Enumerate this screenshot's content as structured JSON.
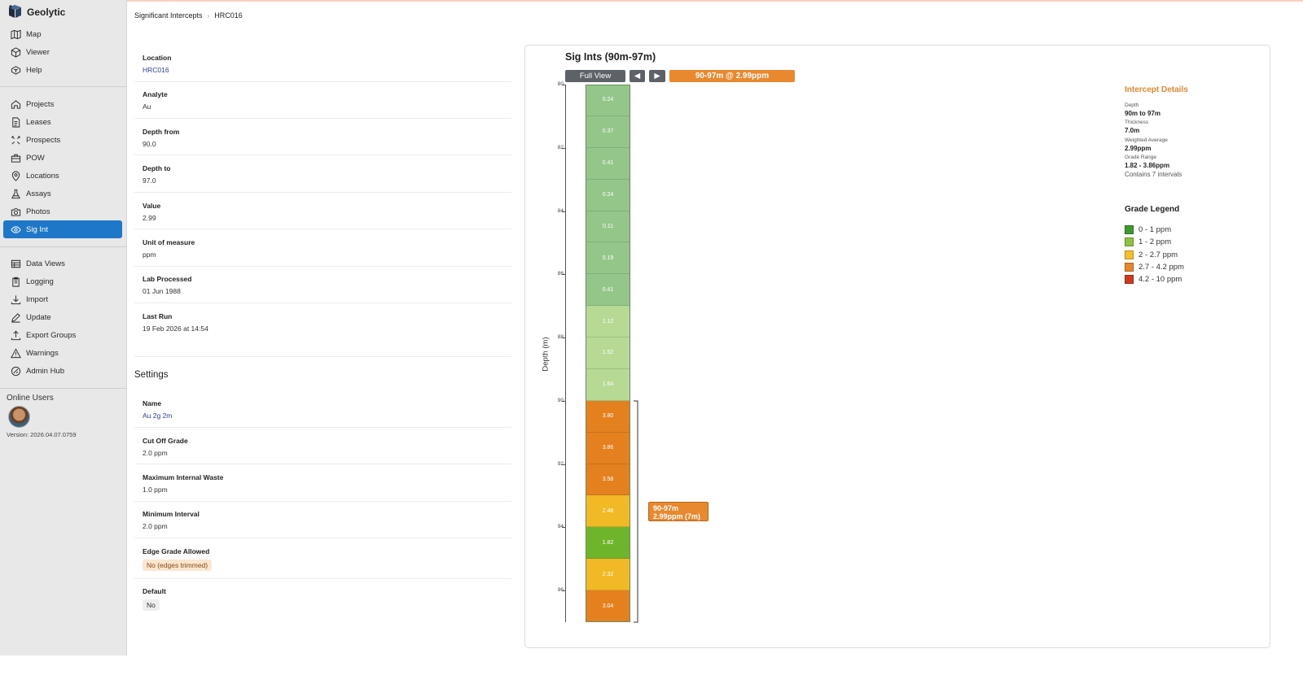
{
  "app": {
    "name": "Geolytic"
  },
  "sidebar": {
    "group1": [
      {
        "label": "Map",
        "icon": "map-icon"
      },
      {
        "label": "Viewer",
        "icon": "cube-icon"
      },
      {
        "label": "Help",
        "icon": "help-icon"
      }
    ],
    "group2": [
      {
        "label": "Projects",
        "icon": "home-icon"
      },
      {
        "label": "Leases",
        "icon": "document-icon"
      },
      {
        "label": "Prospects",
        "icon": "prospects-icon"
      },
      {
        "label": "POW",
        "icon": "briefcase-icon"
      },
      {
        "label": "Locations",
        "icon": "pin-icon"
      },
      {
        "label": "Assays",
        "icon": "flask-icon"
      },
      {
        "label": "Photos",
        "icon": "camera-icon"
      },
      {
        "label": "Sig Int",
        "icon": "eye-icon",
        "active": true
      }
    ],
    "group3": [
      {
        "label": "Data Views",
        "icon": "table-icon"
      },
      {
        "label": "Logging",
        "icon": "clipboard-icon"
      },
      {
        "label": "Import",
        "icon": "download-icon"
      },
      {
        "label": "Update",
        "icon": "edit-icon"
      },
      {
        "label": "Export Groups",
        "icon": "upload-icon"
      },
      {
        "label": "Warnings",
        "icon": "warning-icon"
      },
      {
        "label": "Admin Hub",
        "icon": "admin-icon"
      }
    ],
    "online_users_label": "Online Users",
    "version": "Version: 2026.04.07.0759"
  },
  "breadcrumb": {
    "parent": "Significant Intercepts",
    "current": "HRC016"
  },
  "details": {
    "location": {
      "label": "Location",
      "value": "HRC016"
    },
    "analyte": {
      "label": "Analyte",
      "value": "Au"
    },
    "depth_from": {
      "label": "Depth from",
      "value": "90.0"
    },
    "depth_to": {
      "label": "Depth to",
      "value": "97.0"
    },
    "value": {
      "label": "Value",
      "value": "2.99"
    },
    "unit": {
      "label": "Unit of measure",
      "value": "ppm"
    },
    "lab_processed": {
      "label": "Lab Processed",
      "value": "01 Jun 1988"
    },
    "last_run": {
      "label": "Last Run",
      "value": "19 Feb 2026 at 14:54"
    }
  },
  "settings": {
    "title": "Settings",
    "name": {
      "label": "Name",
      "value": "Au 2g 2m"
    },
    "cutoff": {
      "label": "Cut Off Grade",
      "value": "2.0 ppm"
    },
    "max_waste": {
      "label": "Maximum Internal Waste",
      "value": "1.0 ppm"
    },
    "min_interval": {
      "label": "Minimum Interval",
      "value": "2.0 ppm"
    },
    "edge_grade": {
      "label": "Edge Grade Allowed",
      "value": "No (edges trimmed)"
    },
    "default": {
      "label": "Default",
      "value": "No"
    }
  },
  "chart": {
    "title": "Sig Ints (90m-97m)",
    "full_view_label": "Full View",
    "prev_label": "◀",
    "next_label": "▶",
    "summary_label": "90-97m @ 2.99ppm",
    "ylabel": "Depth (m)",
    "intercept_label_line1": "90-97m",
    "intercept_label_line2": "2.99ppm (7m)"
  },
  "chart_data": {
    "type": "bar",
    "orientation": "vertical-strip",
    "ylim": [
      80,
      97
    ],
    "y_ticks": [
      "80",
      "82",
      "84",
      "86",
      "88",
      "90",
      "92",
      "94",
      "96"
    ],
    "intervals": [
      {
        "from": 80,
        "to": 81,
        "value": "0.24",
        "color": "#93c688"
      },
      {
        "from": 81,
        "to": 82,
        "value": "0.37",
        "color": "#93c688"
      },
      {
        "from": 82,
        "to": 83,
        "value": "0.41",
        "color": "#93c688"
      },
      {
        "from": 83,
        "to": 84,
        "value": "0.24",
        "color": "#93c688"
      },
      {
        "from": 84,
        "to": 85,
        "value": "0.11",
        "color": "#93c688"
      },
      {
        "from": 85,
        "to": 86,
        "value": "0.19",
        "color": "#93c688"
      },
      {
        "from": 86,
        "to": 87,
        "value": "0.41",
        "color": "#93c688"
      },
      {
        "from": 87,
        "to": 88,
        "value": "1.12",
        "color": "#b6d993"
      },
      {
        "from": 88,
        "to": 89,
        "value": "1.52",
        "color": "#b6d993"
      },
      {
        "from": 89,
        "to": 90,
        "value": "1.64",
        "color": "#b6d993"
      },
      {
        "from": 90,
        "to": 91,
        "value": "3.80",
        "color": "#e5801f"
      },
      {
        "from": 91,
        "to": 92,
        "value": "3.86",
        "color": "#e5801f"
      },
      {
        "from": 92,
        "to": 93,
        "value": "3.58",
        "color": "#e5801f"
      },
      {
        "from": 93,
        "to": 94,
        "value": "2.48",
        "color": "#f2b927"
      },
      {
        "from": 94,
        "to": 95,
        "value": "1.82",
        "color": "#6fb52c"
      },
      {
        "from": 95,
        "to": 96,
        "value": "2.32",
        "color": "#f2b927"
      },
      {
        "from": 96,
        "to": 97,
        "value": "3.04",
        "color": "#e5801f"
      }
    ],
    "intercept": {
      "from": 90,
      "to": 97
    }
  },
  "intercept_details": {
    "title": "Intercept Details",
    "depth_label": "Depth",
    "depth_value": "90m to 97m",
    "thickness_label": "Thickness",
    "thickness_value": "7.0m",
    "avg_label": "Weighted Average",
    "avg_value": "2.99ppm",
    "range_label": "Grade Range",
    "range_value": "1.82 - 3.86ppm",
    "note": "Contains 7 intervals"
  },
  "legend": {
    "title": "Grade Legend",
    "items": [
      {
        "label": "0 - 1 ppm",
        "color": "#3f9a2e"
      },
      {
        "label": "1 - 2 ppm",
        "color": "#8cc43f"
      },
      {
        "label": "2 - 2.7 ppm",
        "color": "#f5c02a"
      },
      {
        "label": "2.7 - 4.2 ppm",
        "color": "#e8862c"
      },
      {
        "label": "4.2 - 10 ppm",
        "color": "#cf3a1e"
      }
    ]
  }
}
